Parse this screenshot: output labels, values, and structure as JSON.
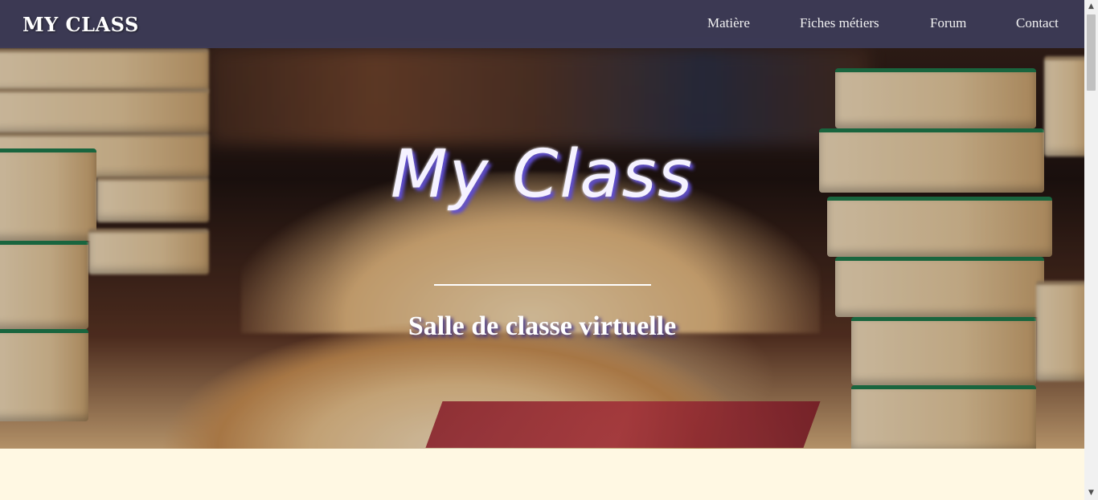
{
  "nav": {
    "brand": "MY CLASS",
    "links": [
      {
        "label": "Matière"
      },
      {
        "label": "Fiches métiers"
      },
      {
        "label": "Forum"
      },
      {
        "label": "Contact"
      }
    ]
  },
  "hero": {
    "title": "My Class",
    "subtitle": "Salle de classe virtuelle",
    "image": "books-library-photo"
  },
  "colors": {
    "navbar": "#3e3e5c",
    "page_background": "#fff8e3",
    "title_shadow": "#5e4dd0"
  },
  "icons": {
    "scroll_up": "chevron-up-icon",
    "scroll_down": "chevron-down-icon"
  }
}
